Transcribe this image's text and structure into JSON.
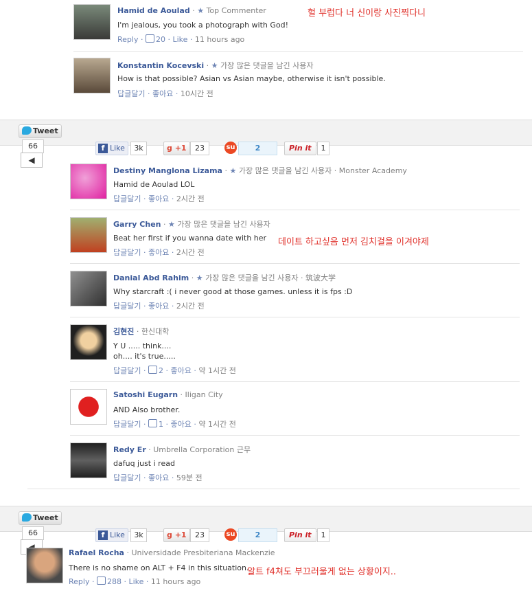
{
  "comments_top": [
    {
      "name": "Hamid de Aoulad",
      "badge": "Top Commenter",
      "text": "I'm jealous, you took a photograph with God!",
      "reply": "Reply",
      "likes": "20",
      "like": "Like",
      "time": "11 hours ago",
      "note": "헐 부럽다 너 신이랑 사진찍다니"
    },
    {
      "name": "Konstantin Kocevski",
      "badge": "가장 많은 댓글을 남긴 사용자",
      "text": "How is that possible? Asian vs Asian maybe, otherwise it isn't possible.",
      "reply": "답글달기",
      "like": "좋아요",
      "time": "10시간 전"
    }
  ],
  "share_bar_1": {
    "tweet": "Tweet",
    "tweet_count": "66",
    "fb_like": "Like",
    "fb_count": "3k",
    "gplus": "+1",
    "gplus_count": "23",
    "su_count": "2",
    "pin": "Pin it",
    "pin_count": "1"
  },
  "comments_mid": [
    {
      "name": "Destiny Manglona Lizama",
      "badge": "가장 많은 댓글을 남긴 사용자",
      "extra": "Monster Academy",
      "text": "Hamid de Aoulad LOL",
      "reply": "답글달기",
      "like": "좋아요",
      "time": "2시간 전"
    },
    {
      "name": "Garry Chen",
      "badge": "가장 많은 댓글을 남긴 사용자",
      "text": "Beat her first if you wanna date with her",
      "reply": "답글달기",
      "like": "좋아요",
      "time": "2시간 전",
      "note": "데이트 하고싶음 먼저 김치걸을 이겨야제"
    },
    {
      "name": "Danial Abd Rahim",
      "badge": "가장 많은 댓글을 남긴 사용자",
      "extra": "筑波大学",
      "text": "Why starcraft :( i never good at those games. unless it is fps :D",
      "reply": "답글달기",
      "like": "좋아요",
      "time": "2시간 전"
    },
    {
      "name": "김현진",
      "extra": "한신대학",
      "text_lines": [
        "Y U ..... think....",
        "oh.... it's true....."
      ],
      "reply": "답글달기",
      "likes": "2",
      "like": "좋아요",
      "time": "약 1시간 전"
    },
    {
      "name": "Satoshi Eugarn",
      "extra": "Iligan City",
      "text": "AND Also brother.",
      "reply": "답글달기",
      "likes": "1",
      "like": "좋아요",
      "time": "약 1시간 전"
    },
    {
      "name": "Redy Er",
      "extra": "Umbrella Corporation 근무",
      "text": "dafuq just i read",
      "reply": "답글달기",
      "like": "좋아요",
      "time": "59분 전"
    }
  ],
  "share_bar_2": {
    "tweet": "Tweet",
    "tweet_count": "66",
    "fb_like": "Like",
    "fb_count": "3k",
    "gplus": "+1",
    "gplus_count": "23",
    "su_count": "2",
    "pin": "Pin it",
    "pin_count": "1"
  },
  "comment_bottom": {
    "name": "Rafael Rocha",
    "extra": "Universidade Presbiteriana Mackenzie",
    "text": "There is no shame on ALT + F4 in this situation.",
    "reply": "Reply",
    "likes": "288",
    "like": "Like",
    "time": "11 hours ago",
    "note": "알트 f4쳐도 부끄러울게 없는 상황이지.."
  },
  "colors": {
    "link": "#3b5998",
    "note": "#e0302a",
    "meta": "#808080"
  }
}
